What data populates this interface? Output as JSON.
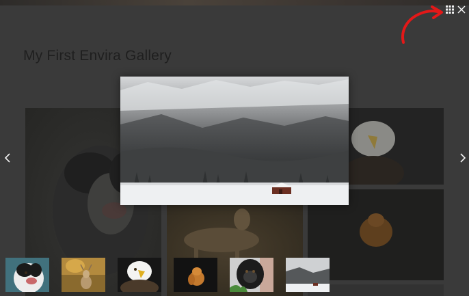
{
  "gallery": {
    "title": "My First Envira Gallery"
  },
  "lightbox": {
    "image_subject": "snowy mountain with wooden cabin",
    "controls": {
      "grid_icon": "grid-icon",
      "close_icon": "close-icon",
      "prev_icon": "chevron-left-icon",
      "next_icon": "chevron-right-icon"
    }
  },
  "thumbnails": [
    {
      "subject": "border collie dog",
      "active": false
    },
    {
      "subject": "deer in forest",
      "active": false
    },
    {
      "subject": "bald eagle",
      "active": false
    },
    {
      "subject": "squirrel",
      "active": false
    },
    {
      "subject": "gorilla",
      "active": false
    },
    {
      "subject": "snowy mountain cabin",
      "active": true
    }
  ],
  "annotation": {
    "color": "#e31818",
    "points_to": "grid-icon"
  },
  "colors": {
    "overlay_bg": "#3a3a3a",
    "icon_color": "#f2f2f2"
  }
}
